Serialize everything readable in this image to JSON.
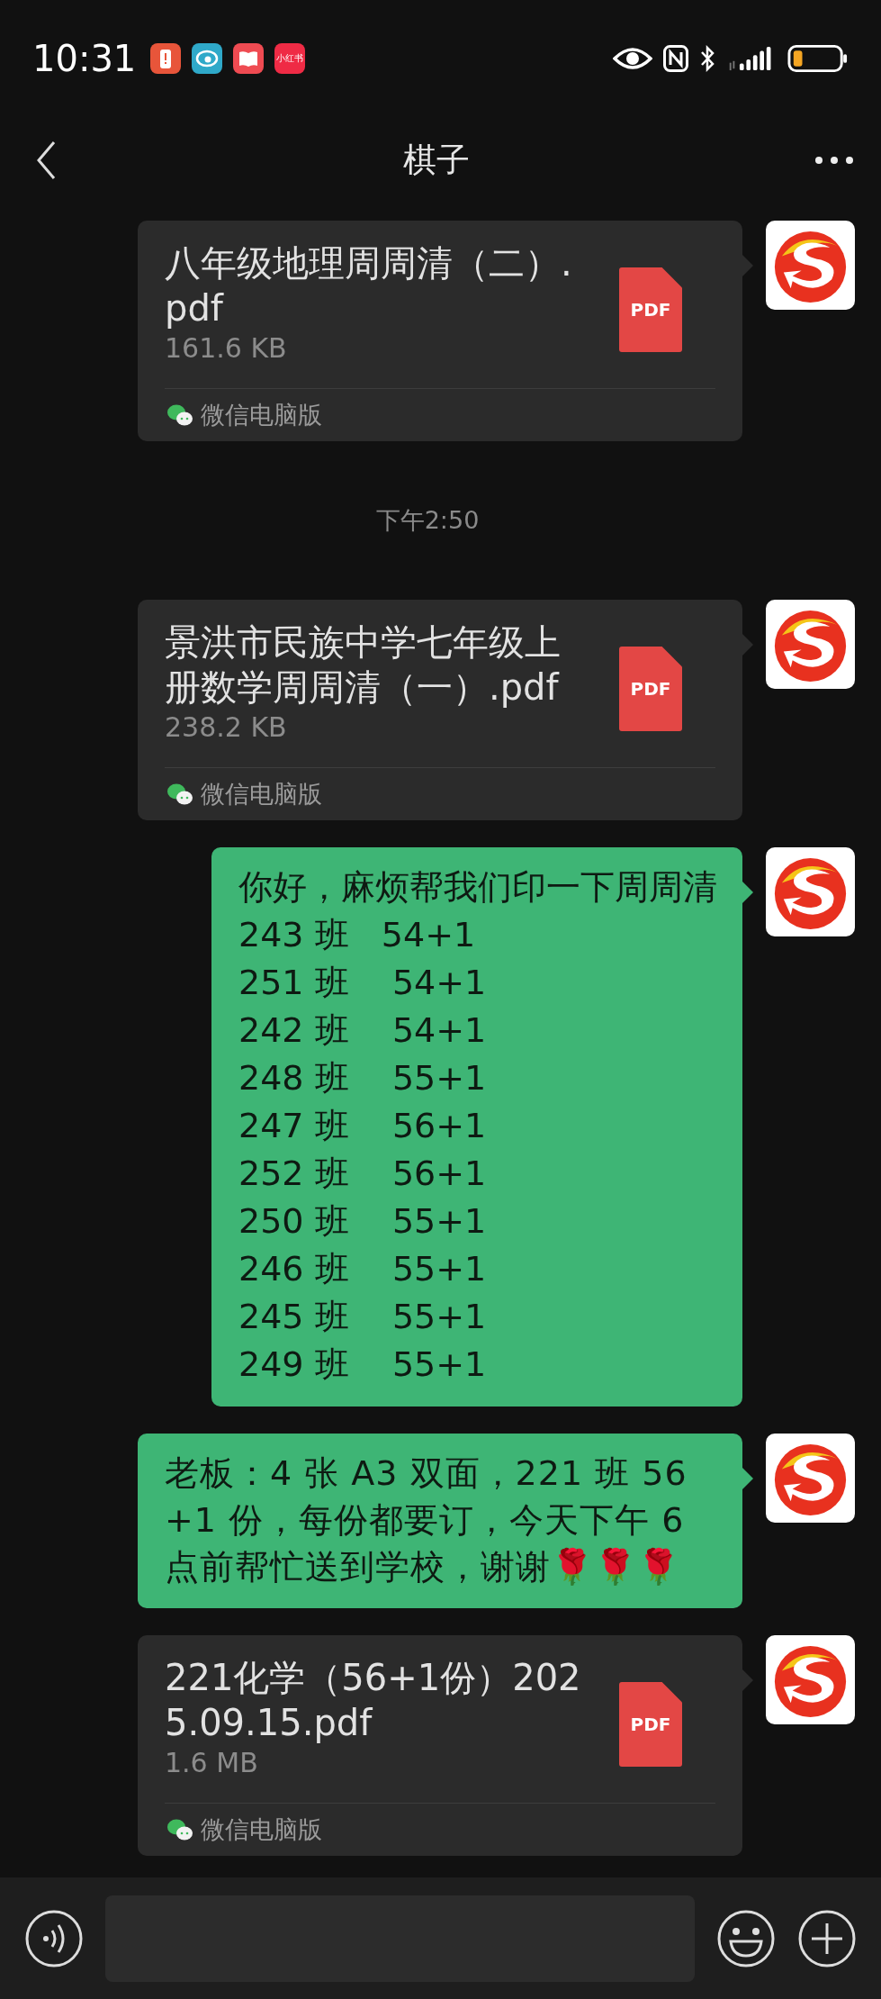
{
  "status_bar": {
    "time": "10:31",
    "notification_badge": "小红书"
  },
  "header": {
    "title": "棋子"
  },
  "messages": [
    {
      "kind": "file",
      "name": "八年级地理周周清（二）.pdf",
      "size": "161.6 KB",
      "file_type": "PDF",
      "source": "微信电脑版"
    },
    {
      "kind": "time",
      "text": "下午2:50"
    },
    {
      "kind": "file",
      "name": "景洪市民族中学七年级上册数学周周清（一）.pdf",
      "size": "238.2 KB",
      "file_type": "PDF",
      "source": "微信电脑版"
    },
    {
      "kind": "lines",
      "lines": [
        "你好，麻烦帮我们印一下周周清",
        "243 班   54+1",
        "251 班    54+1",
        "242 班    54+1",
        "248 班    55+1",
        "247 班    56+1",
        "252 班    56+1",
        "250 班    55+1",
        "246 班    55+1",
        "245 班    55+1",
        "249 班    55+1"
      ]
    },
    {
      "kind": "text",
      "text": "老板：4 张 A3 双面，221 班 56 +1 份，每份都要订，今天下午 6 点前帮忙送到学校，谢谢🌹🌹🌹"
    },
    {
      "kind": "file",
      "name": "221化学（56+1份）2025.09.15.pdf",
      "size": "1.6 MB",
      "file_type": "PDF",
      "source": "微信电脑版"
    }
  ]
}
